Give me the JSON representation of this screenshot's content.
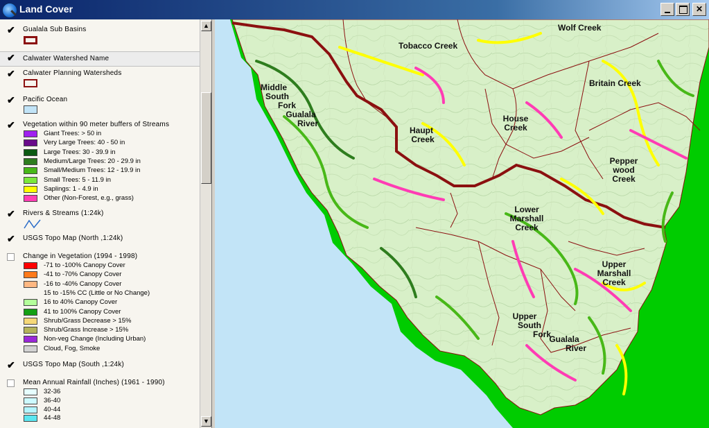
{
  "window": {
    "title": "Land Cover"
  },
  "window_buttons": {
    "minimize": "minimize",
    "maximize": "maximize",
    "close": "close"
  },
  "toc": {
    "layers": [
      {
        "name": "Gualala Sub Basins",
        "checked": true
      },
      {
        "name": "Calwater Watershed Name",
        "checked": true
      },
      {
        "name": "Calwater Planning Watersheds",
        "checked": true
      },
      {
        "name": "Pacific Ocean",
        "checked": true
      },
      {
        "name": "Vegetation within 90 meter buffers of Streams",
        "checked": true
      },
      {
        "name": "Rivers & Streams (1:24k)",
        "checked": true
      },
      {
        "name": "USGS Topo Map (North ,1:24k)",
        "checked": true
      },
      {
        "name": "Change in Vegetation (1994 - 1998)",
        "checked": false
      },
      {
        "name": "USGS Topo Map (South ,1:24k)",
        "checked": true
      },
      {
        "name": "Mean Annual Rainfall (Inches) (1961 - 1990)",
        "checked": false
      }
    ],
    "vegetation_legend": [
      {
        "label": "Giant Trees: > 50 in",
        "color": "#a020f0"
      },
      {
        "label": "Very Large Trees: 40 - 50 in",
        "color": "#6a0a8a"
      },
      {
        "label": "Large Trees: 30 - 39.9 in",
        "color": "#0c5a12"
      },
      {
        "label": "Medium/Large Trees: 20 - 29.9 in",
        "color": "#2e7d1e"
      },
      {
        "label": "Small/Medium Trees: 12 - 19.9 in",
        "color": "#48b818"
      },
      {
        "label": "Small Trees: 5 - 11.9 in",
        "color": "#7ce83c"
      },
      {
        "label": "Saplings: 1 - 4.9 in",
        "color": "#ffff00"
      },
      {
        "label": "Other (Non-Forest, e.g., grass)",
        "color": "#ff3cb4"
      }
    ],
    "change_legend": [
      {
        "label": "-71 to -100% Canopy Cover",
        "color": "#ff0000"
      },
      {
        "label": "-41 to -70% Canopy Cover",
        "color": "#ff7a1a"
      },
      {
        "label": "-16 to -40% Canopy Cover",
        "color": "#ffb882"
      },
      {
        "label": "15 to -15% CC (Little or No Change)",
        "color": ""
      },
      {
        "label": "16 to 40% Canopy Cover",
        "color": "#b4ff9a"
      },
      {
        "label": "41 to 100% Canopy Cover",
        "color": "#14a014"
      },
      {
        "label": "Shrub/Grass Decrease > 15%",
        "color": "#f5d878"
      },
      {
        "label": "Shrub/Grass Increase > 15%",
        "color": "#b4b45a"
      },
      {
        "label": "Non-veg Change (Including Urban)",
        "color": "#9a28d8"
      },
      {
        "label": "Cloud, Fog, Smoke",
        "color": "#d2d2d2"
      }
    ],
    "rainfall_legend": [
      {
        "label": "32-36",
        "color": "#e6ffff"
      },
      {
        "label": "36-40",
        "color": "#cdfaff"
      },
      {
        "label": "40-44",
        "color": "#b4f5ff"
      },
      {
        "label": "44-48",
        "color": "#5ae6f0"
      }
    ]
  },
  "map": {
    "labels": [
      {
        "text": "Wolf Creek"
      },
      {
        "text": "Tobacco Creek"
      },
      {
        "text": "Middle South Fork Gualala River"
      },
      {
        "text": "Britain Creek"
      },
      {
        "text": "House Creek"
      },
      {
        "text": "Haupt Creek"
      },
      {
        "text": "Pepperwood Creek"
      },
      {
        "text": "Lower Marshall Creek"
      },
      {
        "text": "Upper Marshall Creek"
      },
      {
        "text": "Upper South Fork Gualala River"
      }
    ],
    "colors": {
      "ocean": "#c2e4f7",
      "land": "#00cc00",
      "basin": "#d8f0c8",
      "boundary": "#8b1010"
    }
  }
}
